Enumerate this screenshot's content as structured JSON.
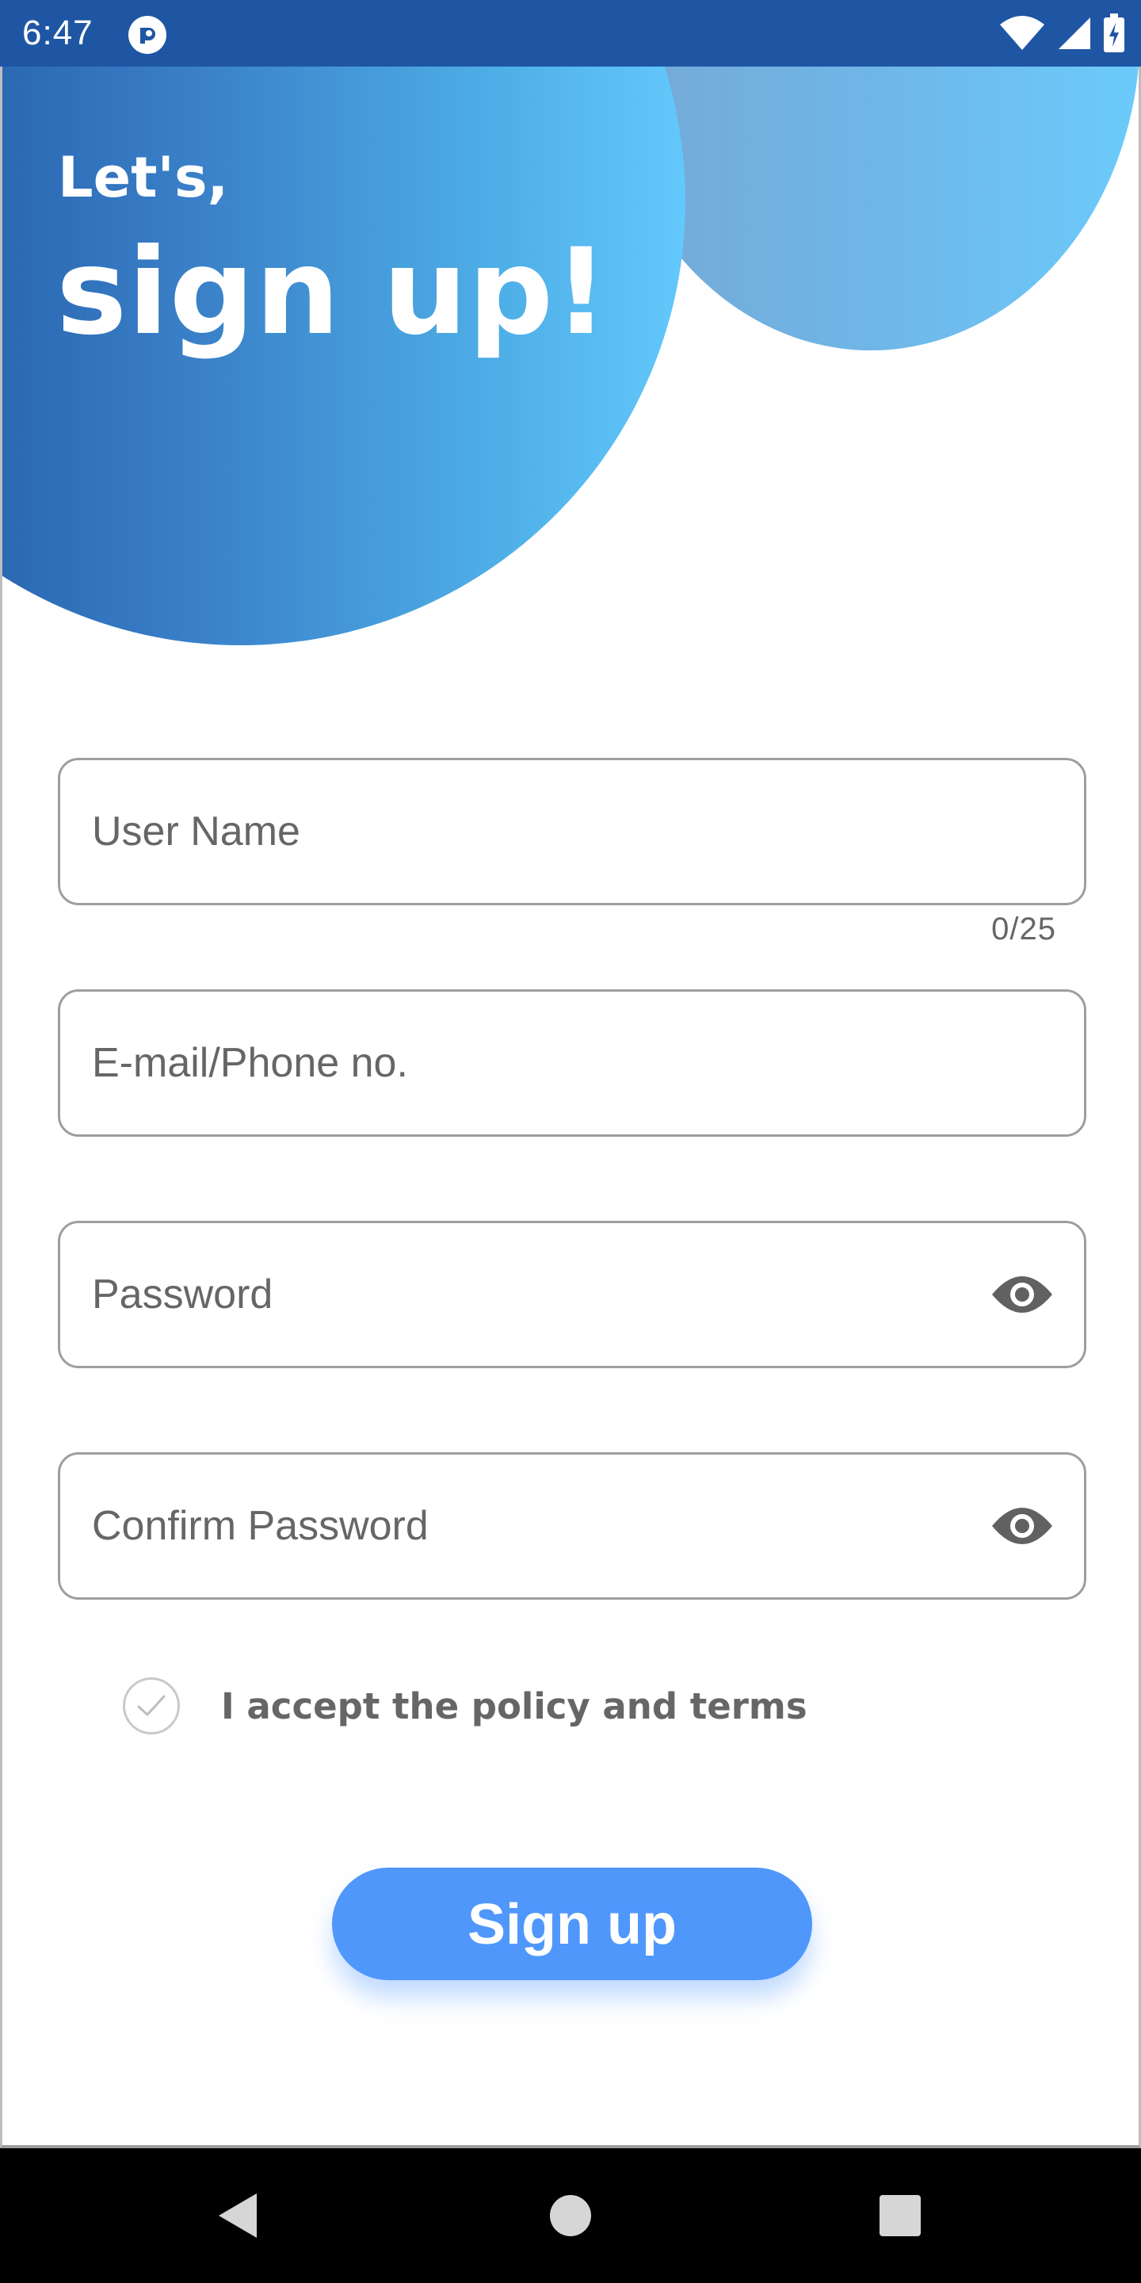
{
  "status_bar": {
    "time": "6:47",
    "icons": [
      "app-notification-icon",
      "wifi-icon",
      "cell-signal-icon",
      "battery-charging-icon"
    ]
  },
  "hero": {
    "greeting": "Let's,",
    "headline": "sign up!"
  },
  "form": {
    "username": {
      "placeholder": "User Name",
      "value": "",
      "counter": "0/25"
    },
    "contact": {
      "placeholder": "E-mail/Phone no.",
      "value": ""
    },
    "password": {
      "placeholder": "Password",
      "value": "",
      "toggle_icon": "eye-icon"
    },
    "confirm_password": {
      "placeholder": "Confirm Password",
      "value": "",
      "toggle_icon": "eye-icon"
    },
    "terms": {
      "label": "I accept the policy and terms",
      "checked": false
    },
    "submit_label": "Sign up"
  },
  "nav_bar": {
    "buttons": [
      "back-icon",
      "home-icon",
      "recents-icon"
    ]
  },
  "colors": {
    "status_bar": "#1f56a4",
    "button": "#4f97fb",
    "field_border": "#9e9e9e",
    "placeholder": "#666666",
    "gradient_dark": "#1b4f9c",
    "gradient_light": "#63c8fb"
  }
}
